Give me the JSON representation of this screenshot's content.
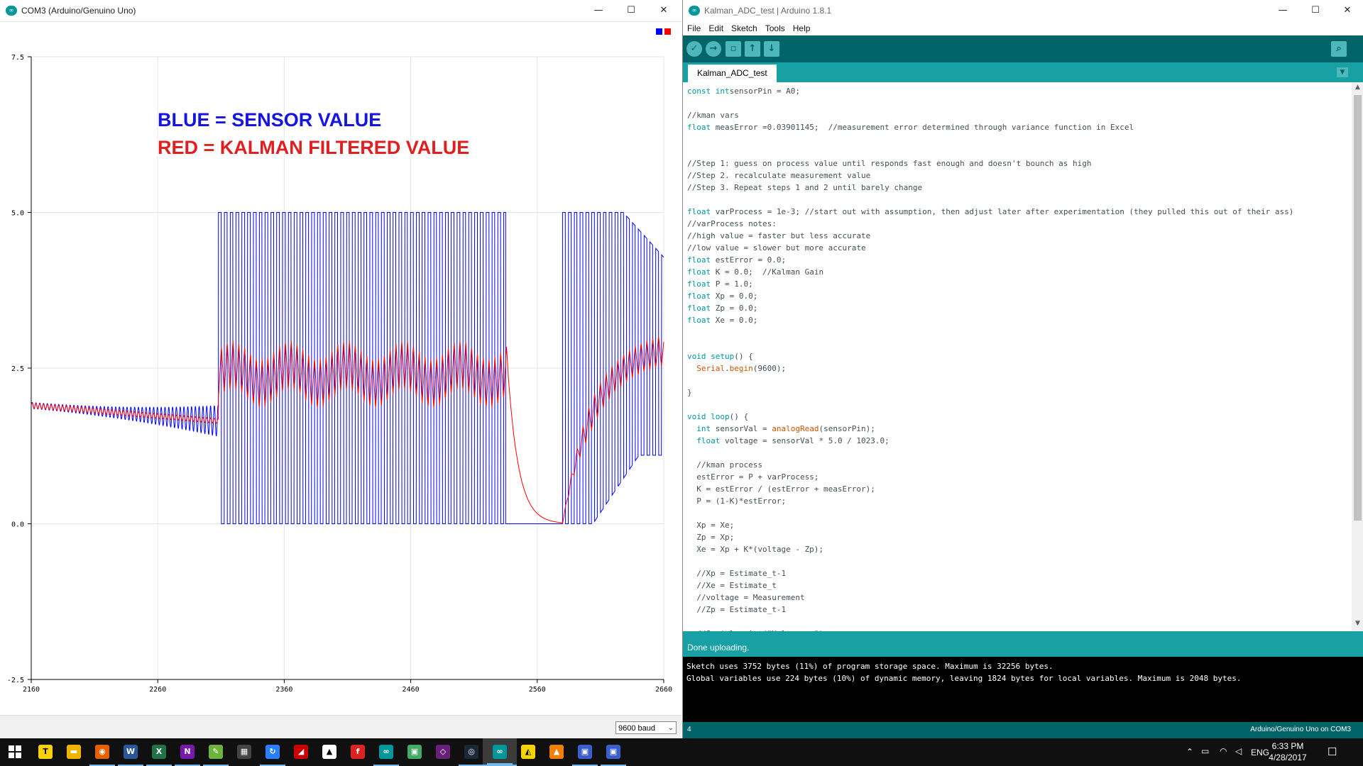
{
  "plotter": {
    "title": "COM3 (Arduino/Genuino Uno)",
    "annotation_blue": "BLUE = SENSOR VALUE",
    "annotation_red": "RED = KALMAN FILTERED VALUE",
    "baud": "9600 baud",
    "legend_colors": [
      "#0000ff",
      "#ff0000"
    ]
  },
  "chart_data": {
    "type": "line",
    "x_ticks": [
      "2160",
      "2260",
      "2360",
      "2460",
      "2560",
      "2660"
    ],
    "y_ticks": [
      "7.5",
      "5.0",
      "2.5",
      "0.0",
      "-2.5"
    ],
    "xlim": [
      2160,
      2660
    ],
    "ylim": [
      -2.5,
      7.5
    ],
    "grid": true,
    "series": [
      {
        "color": "#0000ff",
        "segments": [
          {
            "x0": 2160,
            "x1": 2308,
            "kind": "decay",
            "y0": 1.9,
            "y1": 1.65,
            "amp_from": 0.05,
            "amp_to": 0.25,
            "period": 3
          },
          {
            "x0": 2308,
            "x1": 2535,
            "kind": "square",
            "low": 0.0,
            "high": 5.0,
            "period": 4.6
          },
          {
            "x0": 2535,
            "x1": 2580,
            "kind": "flat",
            "y": 0.0
          },
          {
            "x0": 2580,
            "x1": 2660,
            "kind": "square_decay",
            "low": 0.0,
            "high": 5.0,
            "period": 4.6
          }
        ]
      },
      {
        "color": "#ff0000",
        "segments": [
          {
            "x0": 2160,
            "x1": 2308,
            "kind": "smooth",
            "y0": 1.9,
            "y1": 1.65
          },
          {
            "x0": 2308,
            "x1": 2537,
            "kind": "ripple",
            "center": 2.4,
            "amp": 0.4,
            "period": 4.6
          },
          {
            "x0": 2537,
            "x1": 2580,
            "kind": "fall",
            "from": 2.4,
            "to": 0.0
          },
          {
            "x0": 2580,
            "x1": 2660,
            "kind": "rise",
            "from": 0.0,
            "to": 2.9
          }
        ]
      }
    ]
  },
  "ide": {
    "title": "Kalman_ADC_test | Arduino 1.8.1",
    "menu": [
      "File",
      "Edit",
      "Sketch",
      "Tools",
      "Help"
    ],
    "tab": "Kalman_ADC_test",
    "status": "Done uploading.",
    "console": [
      "Sketch uses 3752 bytes (11%) of program storage space. Maximum is 32256 bytes.",
      "Global variables use 224 bytes (10%) of dynamic memory, leaving 1824 bytes for local variables. Maximum is 2048 bytes."
    ],
    "line": "4",
    "board": "Arduino/Genuino Uno on COM3",
    "code_lines": [
      [
        [
          "kw",
          "const int"
        ],
        [
          "",
          "sensorPin = A0;"
        ]
      ],
      [
        [
          "",
          ""
        ]
      ],
      [
        [
          "cm",
          "//kman vars"
        ]
      ],
      [
        [
          "kw",
          "float"
        ],
        [
          "",
          " measError =0.03901145;  //measurement error determined through variance function in Excel"
        ]
      ],
      [
        [
          "",
          ""
        ]
      ],
      [
        [
          "",
          ""
        ]
      ],
      [
        [
          "cm",
          "//Step 1: guess on process value until responds fast enough and doesn't bounch as high"
        ]
      ],
      [
        [
          "cm",
          "//Step 2. recalculate measurement value"
        ]
      ],
      [
        [
          "cm",
          "//Step 3. Repeat steps 1 and 2 until barely change"
        ]
      ],
      [
        [
          "",
          ""
        ]
      ],
      [
        [
          "kw",
          "float"
        ],
        [
          "",
          " varProcess = 1e-3; //start out with assumption, then adjust later after experimentation (they pulled this out of their ass)"
        ]
      ],
      [
        [
          "cm",
          "//varProcess notes:"
        ]
      ],
      [
        [
          "cm",
          "//high value = faster but less accurate"
        ]
      ],
      [
        [
          "cm",
          "//low value = slower but more accurate"
        ]
      ],
      [
        [
          "kw",
          "float"
        ],
        [
          "",
          " estError = 0.0;"
        ]
      ],
      [
        [
          "kw",
          "float"
        ],
        [
          "",
          " K = 0.0;  //Kalman Gain"
        ]
      ],
      [
        [
          "kw",
          "float"
        ],
        [
          "",
          " P = 1.0;"
        ]
      ],
      [
        [
          "kw",
          "float"
        ],
        [
          "",
          " Xp = 0.0;"
        ]
      ],
      [
        [
          "kw",
          "float"
        ],
        [
          "",
          " Zp = 0.0;"
        ]
      ],
      [
        [
          "kw",
          "float"
        ],
        [
          "",
          " Xe = 0.0;"
        ]
      ],
      [
        [
          "",
          ""
        ]
      ],
      [
        [
          "",
          ""
        ]
      ],
      [
        [
          "kw",
          "void"
        ],
        [
          "",
          " "
        ],
        [
          "kw",
          "setup"
        ],
        [
          "",
          "() {"
        ]
      ],
      [
        [
          "",
          "  "
        ],
        [
          "fn",
          "Serial"
        ],
        [
          "",
          "."
        ],
        [
          "fn",
          "begin"
        ],
        [
          "",
          "(9600);"
        ]
      ],
      [
        [
          "",
          ""
        ]
      ],
      [
        [
          "",
          "}"
        ]
      ],
      [
        [
          "",
          ""
        ]
      ],
      [
        [
          "kw",
          "void"
        ],
        [
          "",
          " "
        ],
        [
          "kw",
          "loop"
        ],
        [
          "",
          "() {"
        ]
      ],
      [
        [
          "",
          "  "
        ],
        [
          "kw",
          "int"
        ],
        [
          "",
          " sensorVal = "
        ],
        [
          "fn",
          "analogRead"
        ],
        [
          "",
          "(sensorPin);"
        ]
      ],
      [
        [
          "",
          "  "
        ],
        [
          "kw",
          "float"
        ],
        [
          "",
          " voltage = sensorVal * 5.0 / 1023.0;"
        ]
      ],
      [
        [
          "",
          ""
        ]
      ],
      [
        [
          "",
          "  //kman process"
        ]
      ],
      [
        [
          "",
          "  estError = P + varProcess;"
        ]
      ],
      [
        [
          "",
          "  K = estError / (estError + measError);"
        ]
      ],
      [
        [
          "",
          "  P = (1-K)*estError;"
        ]
      ],
      [
        [
          "",
          ""
        ]
      ],
      [
        [
          "",
          "  Xp = Xe;"
        ]
      ],
      [
        [
          "",
          "  Zp = Xp;"
        ]
      ],
      [
        [
          "",
          "  Xe = Xp + K*(voltage - Zp);"
        ]
      ],
      [
        [
          "",
          ""
        ]
      ],
      [
        [
          "",
          "  //Xp = Estimate_t-1"
        ]
      ],
      [
        [
          "",
          "  //Xe = Estimate_t"
        ]
      ],
      [
        [
          "",
          "  //voltage = Measurement"
        ]
      ],
      [
        [
          "",
          "  //Zp = Estimate_t-1"
        ]
      ],
      [
        [
          "",
          ""
        ]
      ],
      [
        [
          "",
          "  //Serial.print(\"Voltage: \");"
        ]
      ]
    ]
  },
  "taskbar": {
    "apps": [
      "kakaotalk-icon",
      "file-explorer-icon",
      "firefox-icon",
      "word-icon",
      "excel-icon",
      "onenote-icon",
      "notepad-icon",
      "calculator-icon",
      "sync-icon",
      "vector-app-icon",
      "fox-app-icon",
      "red-app-icon",
      "arduino-icon",
      "printer-icon",
      "visual-studio-icon",
      "steam-icon",
      "arduino-active-icon",
      "autodesk-icon",
      "vlc-icon",
      "network-app-icon",
      "network-app2-icon"
    ],
    "language": "ENG",
    "time": "6:33 PM",
    "date": "4/28/2017"
  }
}
